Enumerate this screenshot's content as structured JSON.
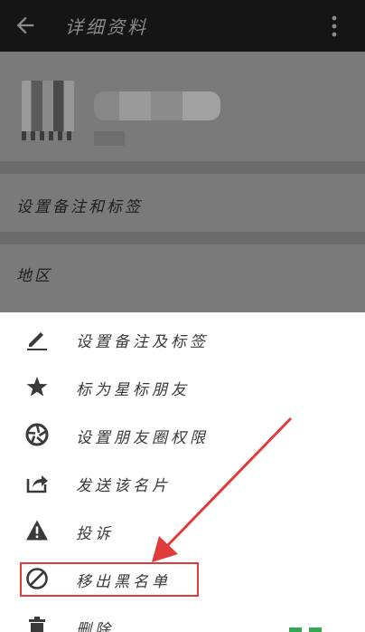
{
  "header": {
    "title": "详细资料"
  },
  "profile": {
    "remark_row": "设置备注和标签",
    "region_row": "地区"
  },
  "menu": {
    "items": [
      {
        "label": "设置备注及标签",
        "icon": "pencil-icon"
      },
      {
        "label": "标为星标朋友",
        "icon": "star-icon"
      },
      {
        "label": "设置朋友圈权限",
        "icon": "aperture-icon"
      },
      {
        "label": "发送该名片",
        "icon": "share-icon"
      },
      {
        "label": "投诉",
        "icon": "warning-icon"
      },
      {
        "label": "移出黑名单",
        "icon": "block-icon"
      },
      {
        "label": "删除",
        "icon": "trash-icon"
      }
    ]
  },
  "annotation": {
    "highlight_color": "#e23b3b"
  }
}
